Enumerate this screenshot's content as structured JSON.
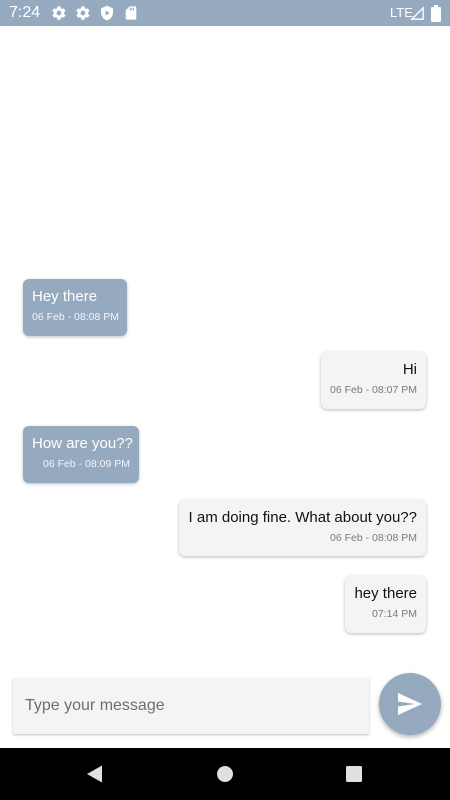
{
  "status_bar": {
    "time": "7:24",
    "network": "LTE",
    "icons": [
      "gear-icon",
      "gear-icon",
      "shield-play-icon",
      "sd-card-icon",
      "signal-icon",
      "battery-icon"
    ],
    "background": "#95a9bf"
  },
  "messages": [
    {
      "direction": "received",
      "text": "Hey there",
      "time": "06 Feb - 08:08 PM"
    },
    {
      "direction": "sent",
      "text": "Hi",
      "time": "06 Feb - 08:07 PM"
    },
    {
      "direction": "received",
      "text": "How are you??",
      "time": "06 Feb - 08:09 PM"
    },
    {
      "direction": "sent",
      "text": "I am doing fine. What about you??",
      "time": "06 Feb - 08:08 PM"
    },
    {
      "direction": "sent",
      "text": "hey there",
      "time": "07:14 PM"
    }
  ],
  "composer": {
    "placeholder": "Type your message",
    "value": "",
    "send_icon": "send-icon"
  },
  "nav_bar": {
    "buttons": [
      "back-icon",
      "home-icon",
      "recents-icon"
    ]
  },
  "colors": {
    "accent": "#95a9bf",
    "sent_bubble": "#f4f4f4",
    "received_bubble": "#95a9bf"
  }
}
